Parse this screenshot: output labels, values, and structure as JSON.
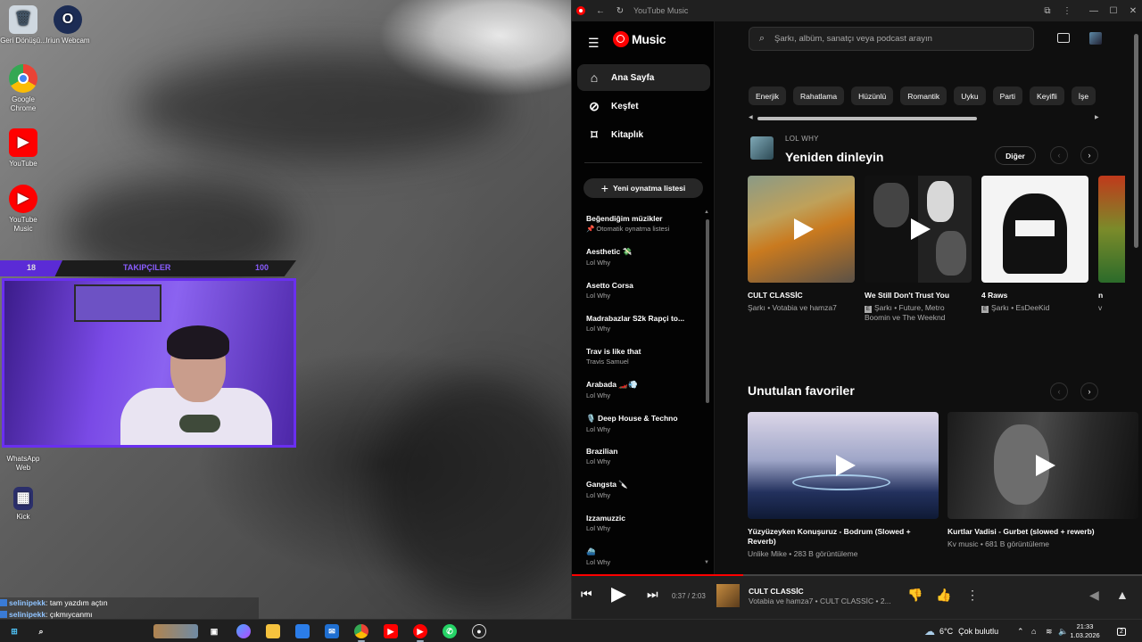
{
  "desktop": {
    "icons": [
      {
        "label": "Geri Dönüşü...",
        "icon": "recycle-bin-icon"
      },
      {
        "label": "Iriun Webcam",
        "icon": "iriun-webcam-icon"
      },
      {
        "label": "Google Chrome",
        "icon": "chrome-icon"
      },
      {
        "label": "YouTube",
        "icon": "youtube-icon"
      },
      {
        "label": "YouTube Music",
        "icon": "youtube-music-icon"
      },
      {
        "label": "WhatsApp Web",
        "icon": "whatsapp-icon"
      },
      {
        "label": "Kick",
        "icon": "kick-icon"
      }
    ]
  },
  "overlay": {
    "left_count": "18",
    "label": "TAKIPÇILER",
    "right_count": "100"
  },
  "chat": [
    {
      "user": "selinipekk",
      "text": ": tam yazdım açtın"
    },
    {
      "user": "selinipekk",
      "text": ": çıkmıycanmı"
    },
    {
      "user": "selinipekk",
      "text": ":"
    }
  ],
  "window": {
    "title": "YouTube Music",
    "controls": [
      "minimize",
      "maximize",
      "close"
    ]
  },
  "sidebar": {
    "logo_text": "Music",
    "nav": [
      {
        "label": "Ana Sayfa",
        "icon": "home-icon",
        "active": true
      },
      {
        "label": "Keşfet",
        "icon": "compass-icon",
        "active": false
      },
      {
        "label": "Kitaplık",
        "icon": "library-icon",
        "active": false
      }
    ],
    "new_playlist": "Yeni oynatma listesi",
    "playlists": [
      {
        "title": "Beğendiğim müzikler",
        "subtitle": "📌 Otomatik oynatma listesi"
      },
      {
        "title": "Aesthetic 💸",
        "subtitle": "Lol Why"
      },
      {
        "title": "Asetto Corsa",
        "subtitle": "Lol Why"
      },
      {
        "title": "Madrabazlar S2k Rapçi to...",
        "subtitle": "Lol Why"
      },
      {
        "title": "Trav is like that",
        "subtitle": "Travis Samuel"
      },
      {
        "title": "Arabada 🏎️💨",
        "subtitle": "Lol Why"
      },
      {
        "title": "🎙️ Deep House & Techno",
        "subtitle": "Lol Why"
      },
      {
        "title": "Brazilian",
        "subtitle": "Lol Why"
      },
      {
        "title": "Gangsta 🔪",
        "subtitle": "Lol Why"
      },
      {
        "title": "Izzamuzzic",
        "subtitle": "Lol Why"
      },
      {
        "title": "⛴️",
        "subtitle": "Lol Why"
      }
    ]
  },
  "main": {
    "search_placeholder": "Şarkı, albüm, sanatçı veya podcast arayın",
    "chips": [
      "Enerjik",
      "Rahatlama",
      "Hüzünlü",
      "Romantik",
      "Uyku",
      "Parti",
      "Keyifli",
      "İşe"
    ],
    "listen_again": {
      "kicker": "LOL WHY",
      "title": "Yeniden dinleyin",
      "more_label": "Diğer",
      "cards": [
        {
          "title": "CULT CLASSİC",
          "subtitle": "Şarkı • Votabia ve hamza7",
          "explicit": false
        },
        {
          "title": "We Still Don't Trust You",
          "subtitle": "Şarkı • Future, Metro Boomin ve The Weeknd",
          "explicit": true
        },
        {
          "title": "4 Raws",
          "subtitle": "Şarkı • EsDeeKid",
          "explicit": true
        },
        {
          "title": "n",
          "subtitle": "v",
          "explicit": true
        }
      ]
    },
    "forgotten": {
      "title": "Unutulan favoriler",
      "cards": [
        {
          "title": "Yüzyüzeyken Konuşuruz - Bodrum (Slowed + Reverb)",
          "subtitle": "Unlike Mike • 283 B görüntüleme"
        },
        {
          "title": "Kurtlar Vadisi - Gurbet (slowed + rewerb)",
          "subtitle": "Kv music • 681 B görüntüleme"
        }
      ]
    }
  },
  "player": {
    "time": "0:37 / 2:03",
    "progress": 0.3,
    "title": "CULT CLASSİC",
    "subtitle": "Votabia ve hamza7 • CULT CLASSİC • 2..."
  },
  "taskbar": {
    "weather_temp": "6°C",
    "weather_text": "Çok bulutlu",
    "time": "21:33",
    "date": "1.03.2026",
    "notification_count": "2"
  },
  "colors": {
    "accent_red": "#ff0000",
    "overlay_purple": "#6a2ff0",
    "bg_dark": "#0f0f0f"
  }
}
